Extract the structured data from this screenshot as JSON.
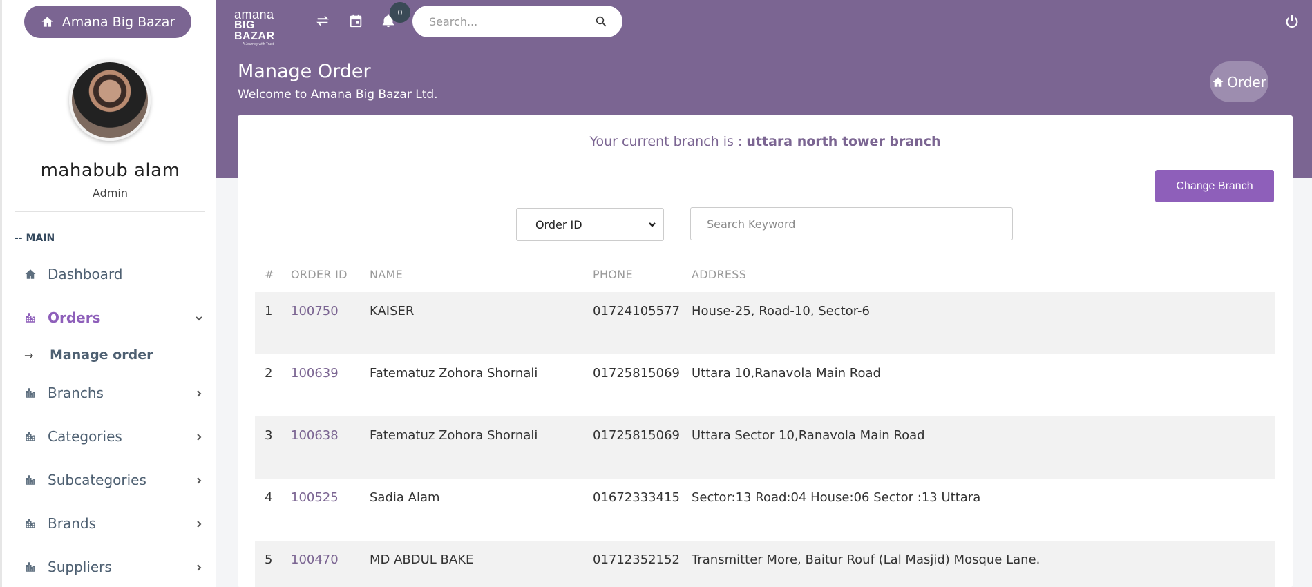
{
  "sidebar": {
    "home_button": "Amana Big Bazar",
    "user_name": "mahabub alam",
    "user_role": "Admin",
    "section_label": "-- MAIN",
    "items": [
      {
        "label": "Dashboard",
        "icon": "home-icon"
      },
      {
        "label": "Orders",
        "icon": "building-icon",
        "active": true
      },
      {
        "label": "Branchs",
        "icon": "building-icon"
      },
      {
        "label": "Categories",
        "icon": "building-icon"
      },
      {
        "label": "Subcategories",
        "icon": "building-icon"
      },
      {
        "label": "Brands",
        "icon": "building-icon"
      },
      {
        "label": "Suppliers",
        "icon": "building-icon"
      }
    ],
    "sub_item": {
      "label": "Manage order",
      "arrow": "→"
    }
  },
  "topbar": {
    "logo_line1": "amana",
    "logo_line2": "BIG BAZAR",
    "logo_tagline": "A Journey with Trust",
    "notification_count": "0",
    "search_placeholder": "Search..."
  },
  "header": {
    "title": "Manage Order",
    "subtitle": "Welcome to Amana Big Bazar Ltd.",
    "breadcrumb": "Order"
  },
  "content": {
    "branch_prefix": "Your current branch is : ",
    "branch_name": "uttara north tower branch",
    "change_branch_button": "Change Branch",
    "filter_select": "Order ID",
    "keyword_placeholder": "Search Keyword",
    "columns": [
      "#",
      "ORDER ID",
      "NAME",
      "PHONE",
      "ADDRESS"
    ],
    "rows": [
      {
        "n": "1",
        "id": "100750",
        "name": "KAISER",
        "phone": "01724105577",
        "address": "House-25, Road-10, Sector-6"
      },
      {
        "n": "2",
        "id": "100639",
        "name": "Fatematuz Zohora Shornali",
        "phone": "01725815069",
        "address": "Uttara 10,Ranavola Main Road"
      },
      {
        "n": "3",
        "id": "100638",
        "name": "Fatematuz Zohora Shornali",
        "phone": "01725815069",
        "address": "Uttara Sector 10,Ranavola Main Road"
      },
      {
        "n": "4",
        "id": "100525",
        "name": "Sadia Alam",
        "phone": "01672333415",
        "address": "Sector:13 Road:04 House:06 Sector :13 Uttara"
      },
      {
        "n": "5",
        "id": "100470",
        "name": "MD ABDUL BAKE",
        "phone": "01712352152",
        "address": "Transmitter More, Baitur Rouf (Lal Masjid) Mosque Lane."
      }
    ]
  },
  "colors": {
    "brand": "#7b6592",
    "accent": "#8e5fba"
  }
}
